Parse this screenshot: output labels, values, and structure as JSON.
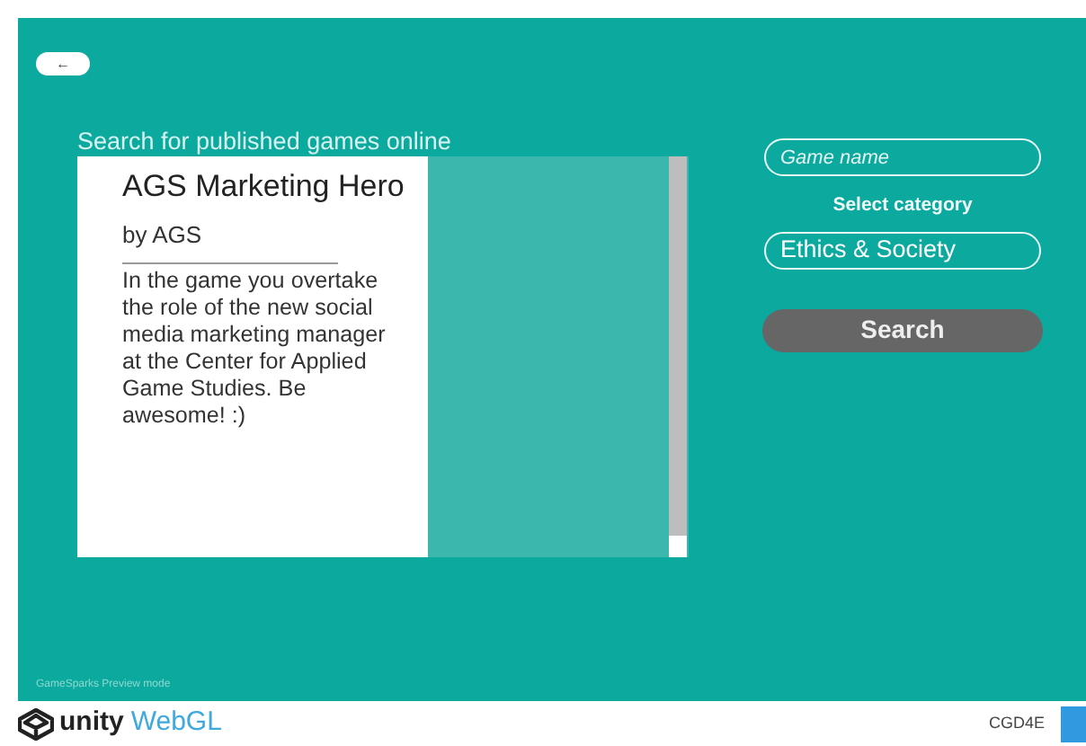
{
  "back_button": {
    "label": "←"
  },
  "heading": "Search for published games online",
  "results": [
    {
      "title": "AGS Marketing Hero",
      "author": "by AGS",
      "description": "In the game you overtake the role of the new social media marketing manager at the Center for Applied Game Studies. Be awesome! :)"
    }
  ],
  "search_panel": {
    "name_field": {
      "placeholder": "Game name"
    },
    "category_label": "Select category",
    "category": "Ethics & Society",
    "search_button": "Search"
  },
  "preview_note": "GameSparks Preview mode",
  "footer": {
    "brand": "unity",
    "product": "WebGL",
    "build": "CGD4E"
  }
}
